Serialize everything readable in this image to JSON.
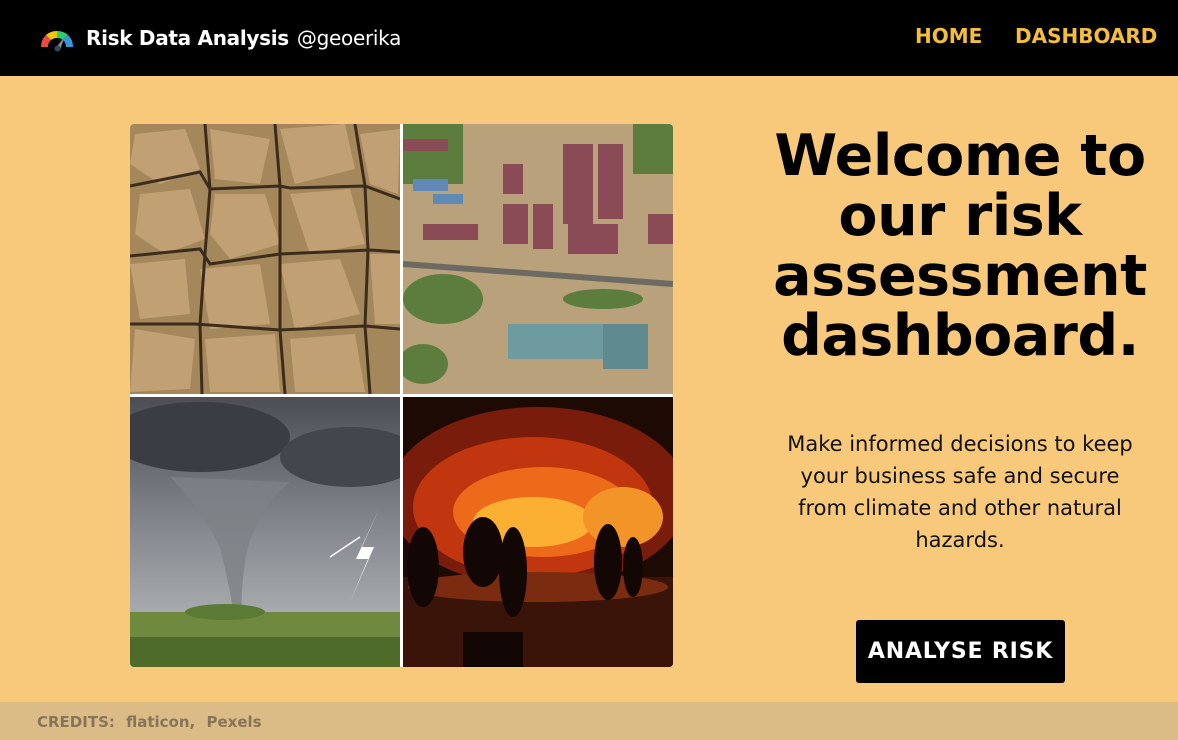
{
  "header": {
    "title": "Risk Data Analysis",
    "handle": "@geoerika",
    "nav": [
      {
        "label": "HOME"
      },
      {
        "label": "DASHBOARD"
      }
    ]
  },
  "hero": {
    "heading": "Welcome to our risk assessment dashboard.",
    "subtext": "Make informed decisions to keep your business safe and secure from climate and other natural hazards.",
    "cta_label": "ANALYSE RISK"
  },
  "images": [
    {
      "icon": "drought-cracked-earth-image"
    },
    {
      "icon": "flooded-town-aerial-image"
    },
    {
      "icon": "tornado-storm-image"
    },
    {
      "icon": "wildfire-firefighters-image"
    }
  ],
  "footer": {
    "credits_label": "CREDITS:",
    "credits": [
      "flaticon,",
      "Pexels"
    ]
  },
  "colors": {
    "background": "#f8c97a",
    "navbar": "#000000",
    "nav_link": "#f4be3b",
    "footer": "#dbbc86",
    "button": "#000000"
  }
}
